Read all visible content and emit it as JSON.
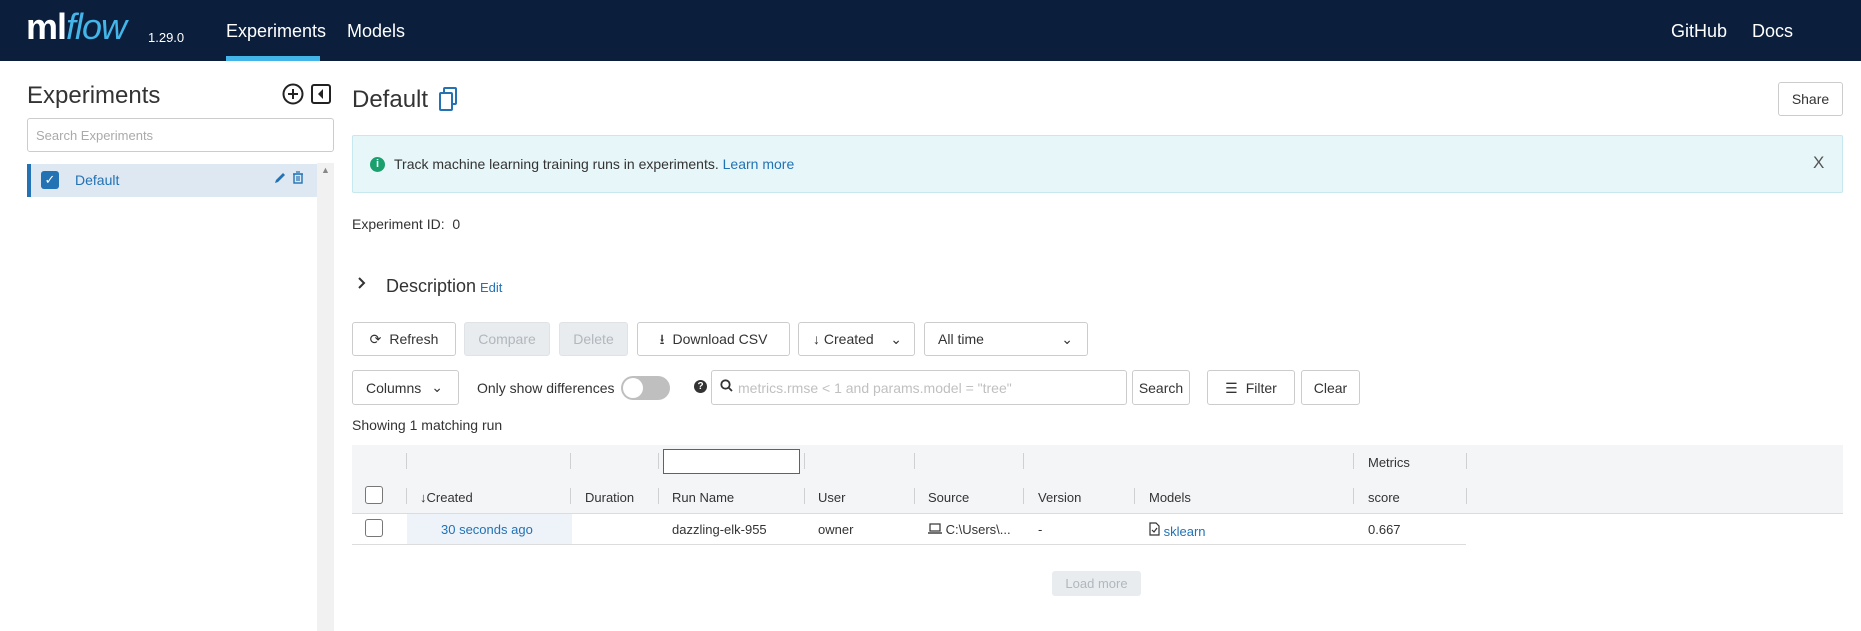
{
  "header": {
    "logo_ml": "ml",
    "logo_flow": "flow",
    "version": "1.29.0",
    "nav": [
      {
        "label": "Experiments"
      },
      {
        "label": "Models"
      }
    ],
    "right_nav": [
      {
        "label": "GitHub"
      },
      {
        "label": "Docs"
      }
    ],
    "active_color": "#43b5e9"
  },
  "sidebar": {
    "title": "Experiments",
    "search_placeholder": "Search Experiments",
    "items": [
      {
        "name": "Default",
        "checked": true
      }
    ]
  },
  "main": {
    "title": "Default",
    "share_label": "Share",
    "banner": {
      "text": "Track machine learning training runs in experiments.",
      "link": "Learn more",
      "close": "X"
    },
    "experiment_id_label": "Experiment ID:",
    "experiment_id": "0",
    "description_label": "Description",
    "description_edit": "Edit",
    "toolbar": {
      "refresh": "Refresh",
      "compare": "Compare",
      "delete": "Delete",
      "download_csv": "Download CSV",
      "sort": "Created",
      "time_range": "All time",
      "columns": "Columns",
      "only_diff": "Only show differences",
      "search_placeholder": "metrics.rmse < 1 and params.model = \"tree\"",
      "search": "Search",
      "filter": "Filter",
      "clear": "Clear"
    },
    "showing": {
      "prefix": "Showing",
      "count": "1",
      "suffix": "matching run"
    },
    "table": {
      "group_header": "Metrics",
      "columns": [
        "Created",
        "Duration",
        "Run Name",
        "User",
        "Source",
        "Version",
        "Models",
        "score"
      ],
      "rows": [
        {
          "created": "30 seconds ago",
          "duration": "",
          "run_name": "dazzling-elk-955",
          "user": "owner",
          "source": "C:\\Users\\...",
          "version": "-",
          "models": "sklearn",
          "score": "0.667"
        }
      ]
    },
    "load_more": "Load more"
  }
}
